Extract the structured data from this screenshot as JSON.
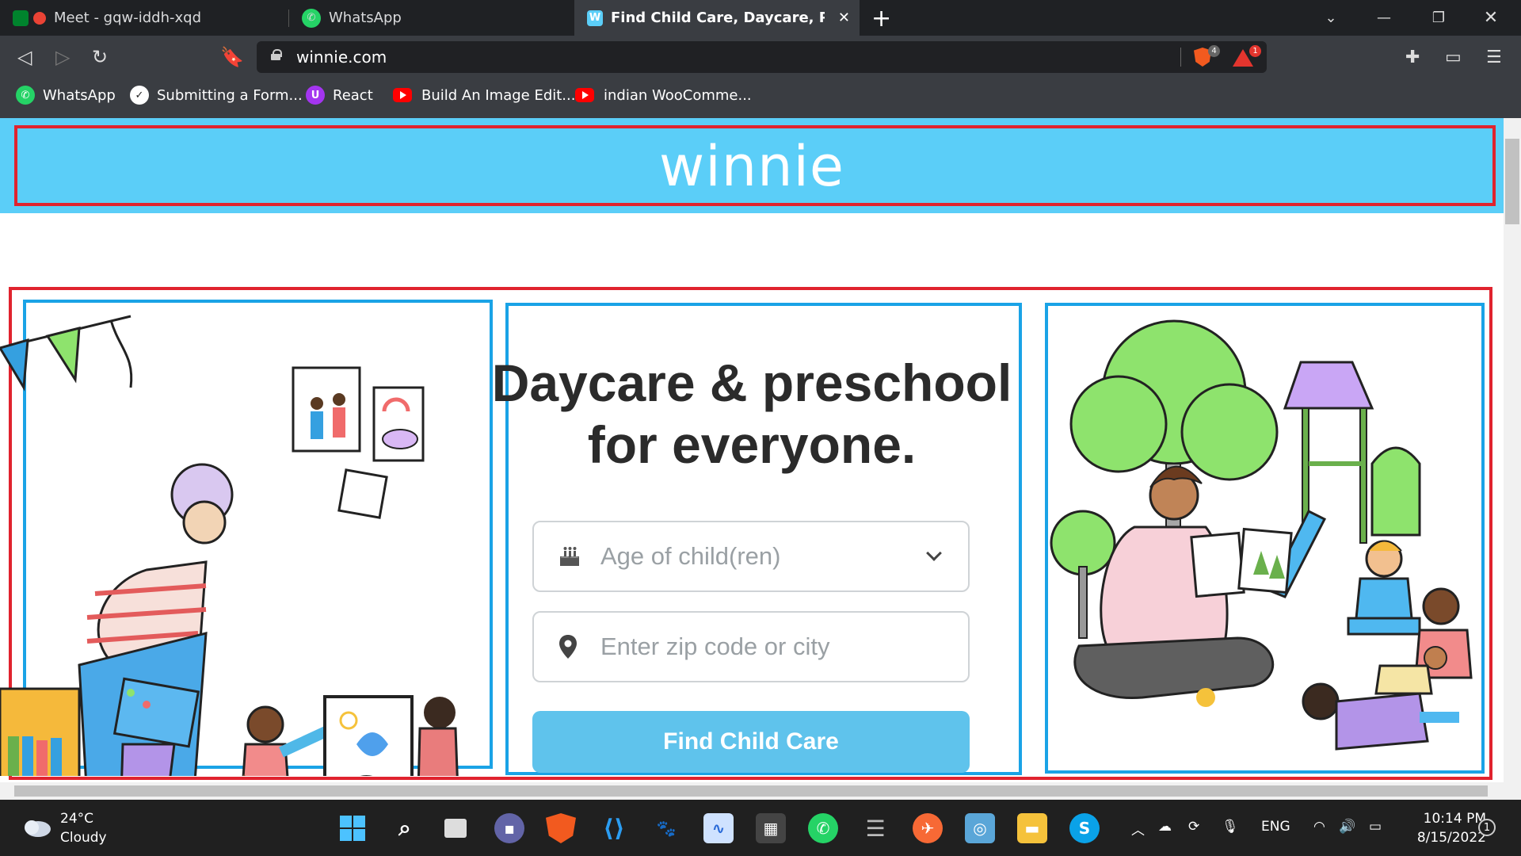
{
  "browser": {
    "tabs": [
      {
        "label": "Meet - gqw-iddh-xqd",
        "active": false
      },
      {
        "label": "WhatsApp",
        "active": false
      },
      {
        "label": "Find Child Care, Daycare, Preschoo",
        "active": true
      }
    ],
    "new_tab_label": "+",
    "url": "winnie.com",
    "shield_count": "4",
    "rewards_count": "1",
    "bookmarks": [
      {
        "label": "WhatsApp",
        "icon": "whatsapp-icon"
      },
      {
        "label": "Submitting a Form...",
        "icon": "check-circle-icon"
      },
      {
        "label": "React",
        "icon": "udemy-icon"
      },
      {
        "label": "Build An Image Edit...",
        "icon": "youtube-icon"
      },
      {
        "label": "indian WooComme...",
        "icon": "youtube-icon"
      }
    ]
  },
  "page": {
    "logo": "winnie",
    "headline_line1": "Daycare & preschool",
    "headline_line2": "for everyone.",
    "age_placeholder": "Age of child(ren)",
    "location_placeholder": "Enter zip code or city",
    "cta_label": "Find Child Care"
  },
  "taskbar": {
    "weather_temp": "24°C",
    "weather_desc": "Cloudy",
    "language": "ENG",
    "time": "10:14 PM",
    "date": "8/15/2022",
    "notification_count": "1"
  },
  "colors": {
    "header_bg": "#5bcef8",
    "cta_bg": "#5fc3ec",
    "annotation_red": "#e0232e",
    "annotation_blue": "#1aa3e6"
  }
}
